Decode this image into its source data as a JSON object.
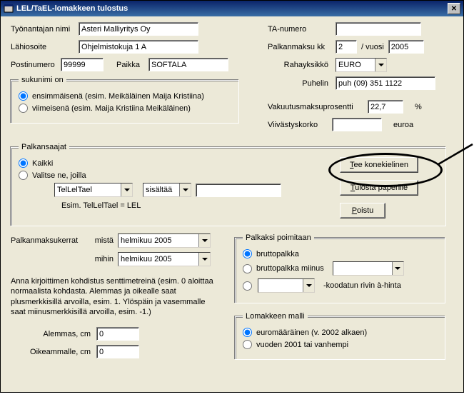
{
  "titlebar": {
    "title": "LEL/TaEL-lomakkeen tulostus"
  },
  "labels": {
    "tyonantaja": "Työnantajan nimi",
    "lahiosoite": "Lähiosoite",
    "postinumero": "Postinumero",
    "paikka": "Paikka",
    "ta_numero": "TA-numero",
    "palkanmaksu_kk": "Palkanmaksu kk",
    "slash_vuosi": "/ vuosi",
    "rahayksikko": "Rahayksikkö",
    "puhelin": "Puhelin",
    "vakuutusmaksu": "Vakuutusmaksuprosentti",
    "pct": "%",
    "viivastyskorko": "Viivästyskorko",
    "euroa": "euroa"
  },
  "values": {
    "tyonantaja": "Asteri Malliyritys Oy",
    "lahiosoite": "Ohjelmistokuja 1 A",
    "postinumero": "99999",
    "paikka": "SOFTALA",
    "ta_numero": "",
    "kk": "2",
    "vuosi": "2005",
    "rahayksikko": "EURO",
    "puhelin": "puh (09) 351 1122",
    "vakuutusmaksu": "22,7",
    "viivastyskorko": ""
  },
  "sukunimi": {
    "legend": "sukunimi on",
    "opt1": "ensimmäisenä (esim. Meikäläinen Maija Kristiina)",
    "opt2": "viimeisenä (esim. Maija Kristiina Meikäläinen)"
  },
  "palkansaajat": {
    "legend": "Palkansaajat",
    "opt1": "Kaikki",
    "opt2": "Valitse ne, joilla",
    "field_select": "TelLelTael",
    "cond_select": "sisältää",
    "cond_value": "",
    "hint": "Esim. TelLelTael = LEL"
  },
  "buttons": {
    "tee": "Tee konekielinen",
    "tulosta": "Tulosta paperille",
    "poistu": "Poistu"
  },
  "palkanmaksukerrat": {
    "label": "Palkanmaksukerrat",
    "mista": "mistä",
    "mihin": "mihin",
    "mista_val": "helmikuu 2005",
    "mihin_val": "helmikuu 2005"
  },
  "kohdistus_help": "Anna kirjoittimen kohdistus senttimetreinä (esim. 0 aloittaa normaalista kohdasta. Alemmas ja oikealle saat plusmerkkisillä arvoilla, esim. 1. Ylöspäin ja vasemmalle saat miinusmerkkisillä arvoilla, esim. -1.)",
  "offsets": {
    "alemmas_lbl": "Alemmas, cm",
    "alemmas_val": "0",
    "oikeammalle_lbl": "Oikeammalle, cm",
    "oikeammalle_val": "0"
  },
  "palkaksi": {
    "legend": "Palkaksi poimitaan",
    "opt1": "bruttopalkka",
    "opt2": "bruttopalkka miinus",
    "opt2_select": "",
    "opt3_select": "",
    "opt3_tail": "-koodatun rivin à-hinta"
  },
  "malli": {
    "legend": "Lomakkeen malli",
    "opt1": "euromääräinen (v. 2002 alkaen)",
    "opt2": "vuoden 2001 tai vanhempi"
  }
}
